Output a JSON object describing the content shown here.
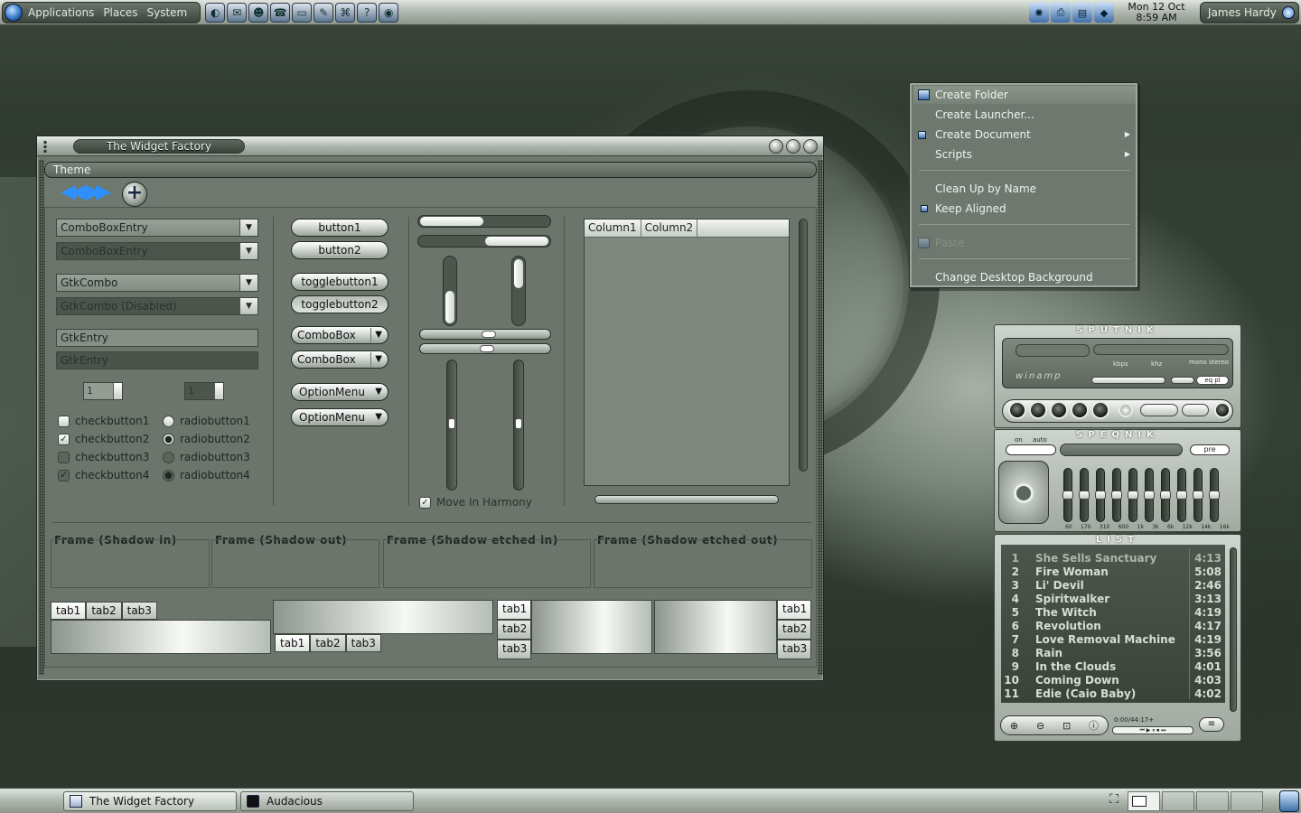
{
  "top_panel": {
    "menus": [
      "Applications",
      "Places",
      "System"
    ],
    "launchers": [
      "browser-icon",
      "mail-icon",
      "chat-icon",
      "phone-icon",
      "terminal-icon",
      "editor-icon",
      "network-icon",
      "help-icon",
      "camera-icon"
    ],
    "tray_icons": [
      "weather-icon",
      "printer-icon",
      "folder-icon",
      "network-status-icon"
    ],
    "clock_date": "Mon 12 Oct",
    "clock_time": "8:59 AM",
    "user": "James Hardy"
  },
  "window": {
    "title": "The Widget Factory",
    "menu": "Theme",
    "combos": [
      {
        "text": "ComboBoxEntry"
      },
      {
        "text": "ComboBoxEntry"
      },
      {
        "text": "GtkCombo"
      },
      {
        "text": "GtkCombo (Disabled)"
      }
    ],
    "entries": [
      "GtkEntry",
      "GtkEntry"
    ],
    "spin_values": [
      "1",
      "1"
    ],
    "checks": [
      "checkbutton1",
      "checkbutton2",
      "checkbutton3",
      "checkbutton4"
    ],
    "radios": [
      "radiobutton1",
      "radiobutton2",
      "radiobutton3",
      "radiobutton4"
    ],
    "buttons": [
      "button1",
      "button2"
    ],
    "toggles": [
      "togglebutton1",
      "togglebutton2"
    ],
    "combo_buttons": [
      "ComboBox",
      "ComboBox"
    ],
    "option_menus": [
      "OptionMenu",
      "OptionMenu"
    ],
    "harmony": "Move In Harmony",
    "columns": [
      "Column1",
      "Column2"
    ],
    "frames": [
      "Frame (Shadow in)",
      "Frame (Shadow out)",
      "Frame (Shadow etched in)",
      "Frame (Shadow etched out)"
    ],
    "tabs": [
      "tab1",
      "tab2",
      "tab3"
    ]
  },
  "context_menu": {
    "items": [
      "Create Folder",
      "Create Launcher...",
      "Create Document",
      "Scripts",
      "Clean Up by Name",
      "Keep Aligned",
      "Paste",
      "Change Desktop Background"
    ]
  },
  "player": {
    "main_title": "SPUTNIK",
    "eq_title": "SPEQNIK",
    "list_title": "LIST",
    "logo": "winamp",
    "labels": {
      "kbps": "kbps",
      "khz": "khz",
      "mono": "mono",
      "stereo": "stereo",
      "on": "on",
      "auto": "auto",
      "eq": "eq",
      "pl": "pl",
      "pre": "pre"
    },
    "eq_bands": [
      "60",
      "170",
      "310",
      "600",
      "1k",
      "3k",
      "6k",
      "12k",
      "14k",
      "16k"
    ],
    "time": "0:00/44:17+",
    "playlist": [
      {
        "n": "1",
        "title": "She Sells Sanctuary",
        "dur": "4:13"
      },
      {
        "n": "2",
        "title": "Fire Woman",
        "dur": "5:08"
      },
      {
        "n": "3",
        "title": "Li' Devil",
        "dur": "2:46"
      },
      {
        "n": "4",
        "title": "Spiritwalker",
        "dur": "3:13"
      },
      {
        "n": "5",
        "title": "The Witch",
        "dur": "4:19"
      },
      {
        "n": "6",
        "title": "Revolution",
        "dur": "4:17"
      },
      {
        "n": "7",
        "title": "Love Removal Machine",
        "dur": "4:19"
      },
      {
        "n": "8",
        "title": "Rain",
        "dur": "3:56"
      },
      {
        "n": "9",
        "title": "In the Clouds",
        "dur": "4:01"
      },
      {
        "n": "10",
        "title": "Coming Down",
        "dur": "4:03"
      },
      {
        "n": "11",
        "title": "Edie (Caio Baby)",
        "dur": "4:02"
      }
    ]
  },
  "taskbar": {
    "tasks": [
      "The Widget Factory",
      "Audacious"
    ]
  }
}
